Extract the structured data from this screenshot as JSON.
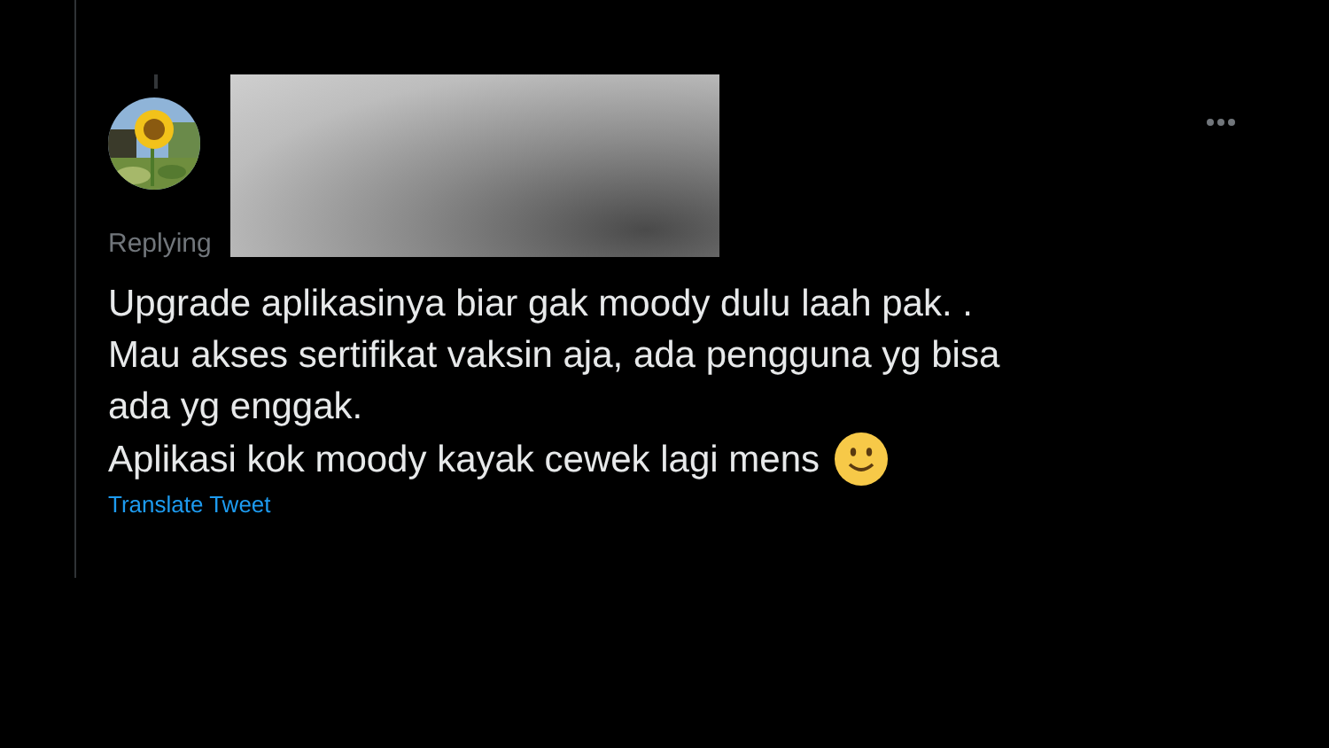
{
  "tweet": {
    "replying_to": "Replying",
    "lines": [
      "Upgrade aplikasinya biar gak moody dulu laah pak. .",
      "Mau akses sertifikat vaksin aja, ada pengguna yg bisa",
      "ada yg enggak.",
      "Aplikasi kok moody kayak cewek lagi mens"
    ],
    "translate": "Translate Tweet"
  }
}
